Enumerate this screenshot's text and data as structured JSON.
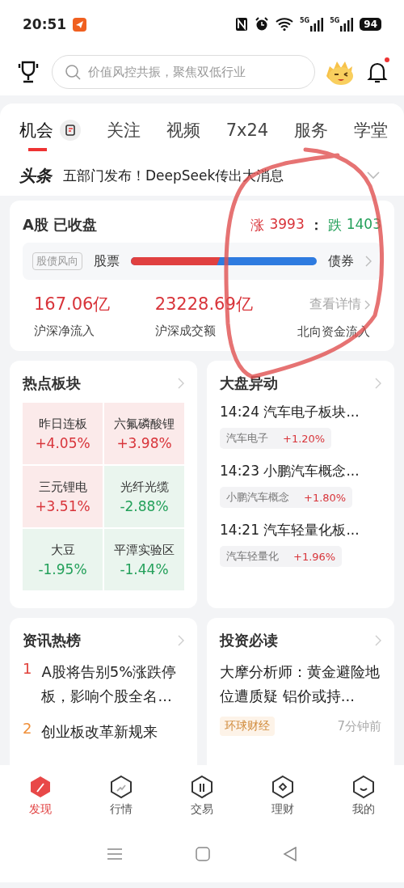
{
  "status_bar": {
    "time": "20:51",
    "networks": [
      "5G",
      "5G"
    ],
    "battery": "94"
  },
  "search": {
    "placeholder": "价值风控共振，聚焦双低行业"
  },
  "tabs": [
    {
      "label": "机会",
      "selected": true
    },
    {
      "label": "关注",
      "selected": false
    },
    {
      "label": "视频",
      "selected": false
    },
    {
      "label": "7x24",
      "selected": false
    },
    {
      "label": "服务",
      "selected": false
    },
    {
      "label": "学堂",
      "selected": false
    }
  ],
  "headline": {
    "source": "头条",
    "text": "五部门发布！DeepSeek传出大消息"
  },
  "market": {
    "title": "A股 已收盘",
    "up_label": "涨",
    "up_count": "3993",
    "separator": "：",
    "down_label": "跌",
    "down_count": "1403",
    "wind": {
      "tag": "股债风向",
      "left": "股票",
      "right": "债券",
      "level": 0.48
    },
    "stats": [
      {
        "kind": "value",
        "value": "167.06亿",
        "label": "沪深净流入"
      },
      {
        "kind": "value",
        "value": "23228.69亿",
        "label": "沪深成交额"
      },
      {
        "kind": "link",
        "value": "查看详情",
        "label": "北向资金流入"
      }
    ]
  },
  "hot_sectors": {
    "title": "热点板块",
    "columns": [
      {
        "cells": [
          {
            "name": "昨日连板",
            "change": "+4.05%",
            "kind": "up"
          },
          {
            "name": "三元锂电",
            "change": "+3.51%",
            "kind": "up"
          },
          {
            "name": "大豆",
            "change": "-1.95%",
            "kind": "down"
          }
        ]
      },
      {
        "cells": [
          {
            "name": "六氟磷酸锂",
            "change": "+3.98%",
            "kind": "up"
          },
          {
            "name": "光纤光缆",
            "change": "-2.88%",
            "kind": "down"
          },
          {
            "name": "平潭实验区",
            "change": "-1.44%",
            "kind": "down"
          }
        ]
      }
    ]
  },
  "market_moves": {
    "title": "大盘异动",
    "items": [
      {
        "text": "14:24 汽车电子板块...",
        "tag": "汽车电子",
        "change": "+1.20%"
      },
      {
        "text": "14:23 小鹏汽车概念...",
        "tag": "小鹏汽车概念",
        "change": "+1.80%"
      },
      {
        "text": "14:21 汽车轻量化板...",
        "tag": "汽车轻量化",
        "change": "+1.96%"
      }
    ]
  },
  "news_hot": {
    "title": "资讯热榜",
    "items": [
      {
        "rank": "1",
        "color": "#e0403a",
        "text": "A股将告别5%涨跌停板，影响个股全名..."
      },
      {
        "rank": "2",
        "color": "#f0903a",
        "text": "创业板改革新规来"
      }
    ]
  },
  "must_read": {
    "title": "投资必读",
    "text": "大摩分析师：黄金避险地位遭质疑 铝价或持...",
    "source": "环球财经",
    "time": "7分钟前"
  },
  "bottom_nav": [
    {
      "label": "发现",
      "selected": true
    },
    {
      "label": "行情",
      "selected": false
    },
    {
      "label": "交易",
      "selected": false
    },
    {
      "label": "理财",
      "selected": false
    },
    {
      "label": "我的",
      "selected": false
    }
  ]
}
